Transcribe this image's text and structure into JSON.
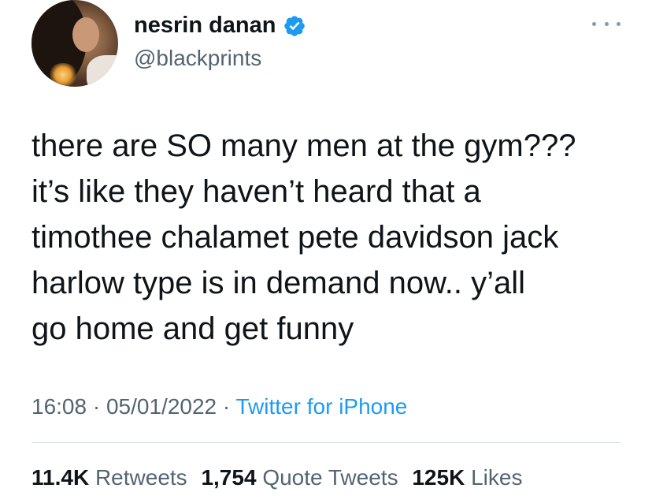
{
  "author": {
    "display_name": "nesrin danan",
    "handle": "@blackprints",
    "verified_icon": "verified-badge-icon",
    "avatar_icon": "profile-photo"
  },
  "tweet": {
    "text": "there are SO many men at the gym???\nit’s like they haven’t heard that a\ntimothee chalamet pete davidson jack\nharlow type is in demand now.. y’all\ngo home and get funny",
    "time": "16:08",
    "separator": "·",
    "date": "05/01/2022",
    "source": "Twitter for iPhone"
  },
  "stats": {
    "retweets_count": "11.4K",
    "retweets_label": "Retweets",
    "quotes_count": "1,754",
    "quotes_label": "Quote Tweets",
    "likes_count": "125K",
    "likes_label": "Likes"
  },
  "colors": {
    "text_primary": "#0f1419",
    "text_secondary": "#536471",
    "link": "#1d9bf0",
    "verified": "#1d9bf0",
    "divider": "#cfd9de"
  }
}
